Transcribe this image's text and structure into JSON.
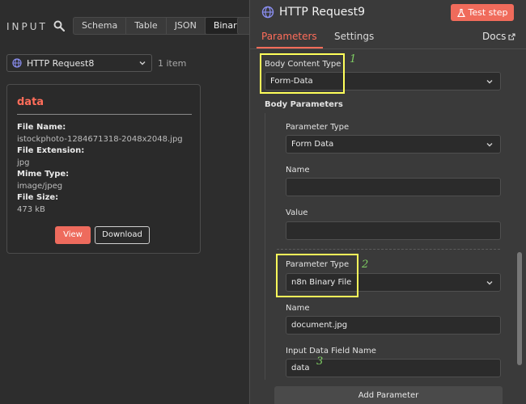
{
  "input_panel": {
    "title": "INPUT",
    "view_tabs": [
      "Schema",
      "Table",
      "JSON",
      "Binary"
    ],
    "active_view": "Binary",
    "node_select": {
      "value": "HTTP Request8"
    },
    "item_count": "1 item",
    "binary_card": {
      "title": "data",
      "fields": [
        {
          "label": "File Name:",
          "value": "istockphoto-1284671318-2048x2048.jpg"
        },
        {
          "label": "File Extension:",
          "value": "jpg"
        },
        {
          "label": "Mime Type:",
          "value": "image/jpeg"
        },
        {
          "label": "File Size:",
          "value": "473 kB"
        }
      ],
      "view_label": "View",
      "download_label": "Download"
    }
  },
  "node_panel": {
    "title": "HTTP Request9",
    "test_step_label": "Test step",
    "tabs": {
      "parameters": "Parameters",
      "settings": "Settings",
      "docs": "Docs"
    },
    "body_content_type": {
      "label": "Body Content Type",
      "value": "Form-Data"
    },
    "body_parameters_label": "Body Parameters",
    "params": [
      {
        "type_label": "Parameter Type",
        "type_value": "Form Data",
        "name_label": "Name",
        "name_value": "",
        "value_label": "Value",
        "value_value": ""
      },
      {
        "type_label": "Parameter Type",
        "type_value": "n8n Binary File",
        "name_label": "Name",
        "name_value": "document.jpg",
        "field_label": "Input Data Field Name",
        "field_value": "data"
      }
    ],
    "add_parameter_label": "Add Parameter"
  },
  "annotations": [
    "1",
    "2",
    "3"
  ],
  "colors": {
    "accent": "#ff6d5a",
    "highlight": "#ffff5a",
    "annotation": "#7fcf63"
  },
  "icons": [
    "search-icon",
    "globe-icon",
    "chevron-down-icon",
    "flask-icon",
    "external-link-icon",
    "pin-icon"
  ]
}
